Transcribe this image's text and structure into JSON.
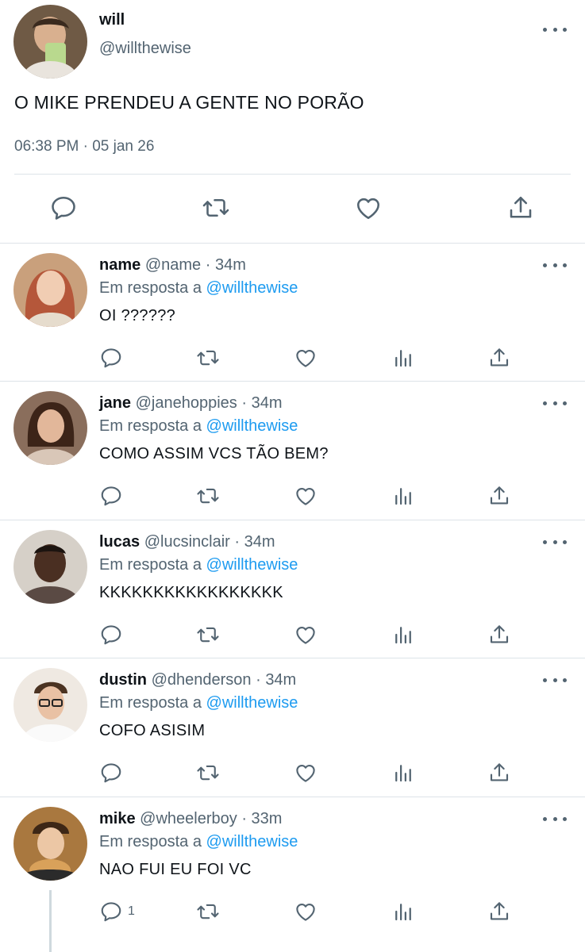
{
  "main_tweet": {
    "name": "will",
    "handle": "@willthewise",
    "text": "O MIKE PRENDEU A GENTE NO PORÃO",
    "timestamp": "06:38 PM · 05 jan 26",
    "actions": [
      "reply-icon",
      "retweet-icon",
      "like-icon",
      "share-icon"
    ]
  },
  "replies": [
    {
      "name": "name",
      "handle": "@name",
      "dot": "·",
      "time": "34m",
      "reply_prefix": "Em resposta a",
      "reply_to": "@willthewise",
      "text": "OI ??????",
      "reply_count": ""
    },
    {
      "name": "jane",
      "handle": "@janehoppies",
      "dot": "·",
      "time": "34m",
      "reply_prefix": "Em resposta a",
      "reply_to": "@willthewise",
      "text": "COMO ASSIM VCS TÃO BEM?",
      "reply_count": ""
    },
    {
      "name": "lucas",
      "handle": "@lucsinclair",
      "dot": "·",
      "time": "34m",
      "reply_prefix": "Em resposta a",
      "reply_to": "@willthewise",
      "text": "KKKKKKKKKKKKKKKKK",
      "reply_count": ""
    },
    {
      "name": "dustin",
      "handle": "@dhenderson",
      "dot": "·",
      "time": "34m",
      "reply_prefix": "Em resposta a",
      "reply_to": "@willthewise",
      "text": "COFO ASISIM",
      "reply_count": ""
    },
    {
      "name": "mike",
      "handle": "@wheelerboy",
      "dot": "·",
      "time": "33m",
      "reply_prefix": "Em resposta a",
      "reply_to": "@willthewise",
      "text": "NAO FUI EU FOI VC",
      "reply_count": "1"
    }
  ],
  "colors": {
    "text": "#0f1419",
    "secondary": "#536471",
    "link": "#1d9bf0",
    "divider": "#dde3e8"
  }
}
